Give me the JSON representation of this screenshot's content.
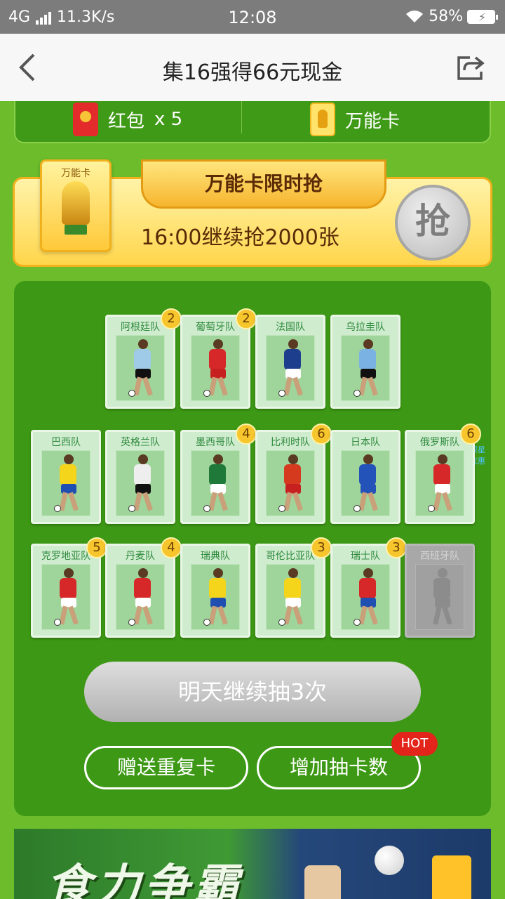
{
  "status_bar": {
    "network": "4G",
    "speed": "11.3K/s",
    "time": "12:08",
    "battery": "58%"
  },
  "header": {
    "title": "集16强得66元现金"
  },
  "rewards": {
    "redpack_label": "红包",
    "redpack_count": "x 5",
    "wildcard_label": "万能卡"
  },
  "banner": {
    "card_label": "万能卡",
    "ribbon": "万能卡限时抢",
    "subtitle": "16:00继续抢2000张",
    "grab_button": "抢"
  },
  "watermark": "探星 优惠",
  "cards": [
    {
      "team": "阿根廷队",
      "count": "2",
      "shirt": "#9fcbe8",
      "shorts": "#111111",
      "locked": false
    },
    {
      "team": "葡萄牙队",
      "count": "2",
      "shirt": "#d62828",
      "shorts": "#c62020",
      "locked": false
    },
    {
      "team": "法国队",
      "count": "",
      "shirt": "#1d3e8c",
      "shorts": "#ffffff",
      "locked": false
    },
    {
      "team": "乌拉圭队",
      "count": "",
      "shirt": "#7ab2e3",
      "shorts": "#111111",
      "locked": false
    },
    {
      "team": "巴西队",
      "count": "",
      "shirt": "#f5d41c",
      "shorts": "#1f4fb0",
      "locked": false
    },
    {
      "team": "英格兰队",
      "count": "",
      "shirt": "#eeeeee",
      "shorts": "#111111",
      "locked": false
    },
    {
      "team": "墨西哥队",
      "count": "4",
      "shirt": "#1f7a3a",
      "shorts": "#ffffff",
      "locked": false
    },
    {
      "team": "比利时队",
      "count": "6",
      "shirt": "#d63a1e",
      "shorts": "#c62020",
      "locked": false
    },
    {
      "team": "日本队",
      "count": "",
      "shirt": "#2352b8",
      "shorts": "#2352b8",
      "locked": false
    },
    {
      "team": "俄罗斯队",
      "count": "6",
      "shirt": "#d62828",
      "shorts": "#ffffff",
      "locked": false
    },
    {
      "team": "克罗地亚队",
      "count": "5",
      "shirt": "#d62828",
      "shorts": "#ffffff",
      "locked": false
    },
    {
      "team": "丹麦队",
      "count": "4",
      "shirt": "#d62828",
      "shorts": "#ffffff",
      "locked": false
    },
    {
      "team": "瑞典队",
      "count": "",
      "shirt": "#f5d41c",
      "shorts": "#1f4fb0",
      "locked": false
    },
    {
      "team": "哥伦比亚队",
      "count": "3",
      "shirt": "#f5d41c",
      "shorts": "#ffffff",
      "locked": false
    },
    {
      "team": "瑞士队",
      "count": "3",
      "shirt": "#d62828",
      "shorts": "#1f4fb0",
      "locked": false
    },
    {
      "team": "西班牙队",
      "count": "",
      "shirt": "#8c8c8c",
      "shorts": "#8c8c8c",
      "locked": true
    }
  ],
  "buttons": {
    "draw": "明天继续抽3次",
    "gift": "赠送重复卡",
    "add": "增加抽卡数",
    "hot": "HOT"
  },
  "ad": {
    "text": "食力争霸"
  }
}
